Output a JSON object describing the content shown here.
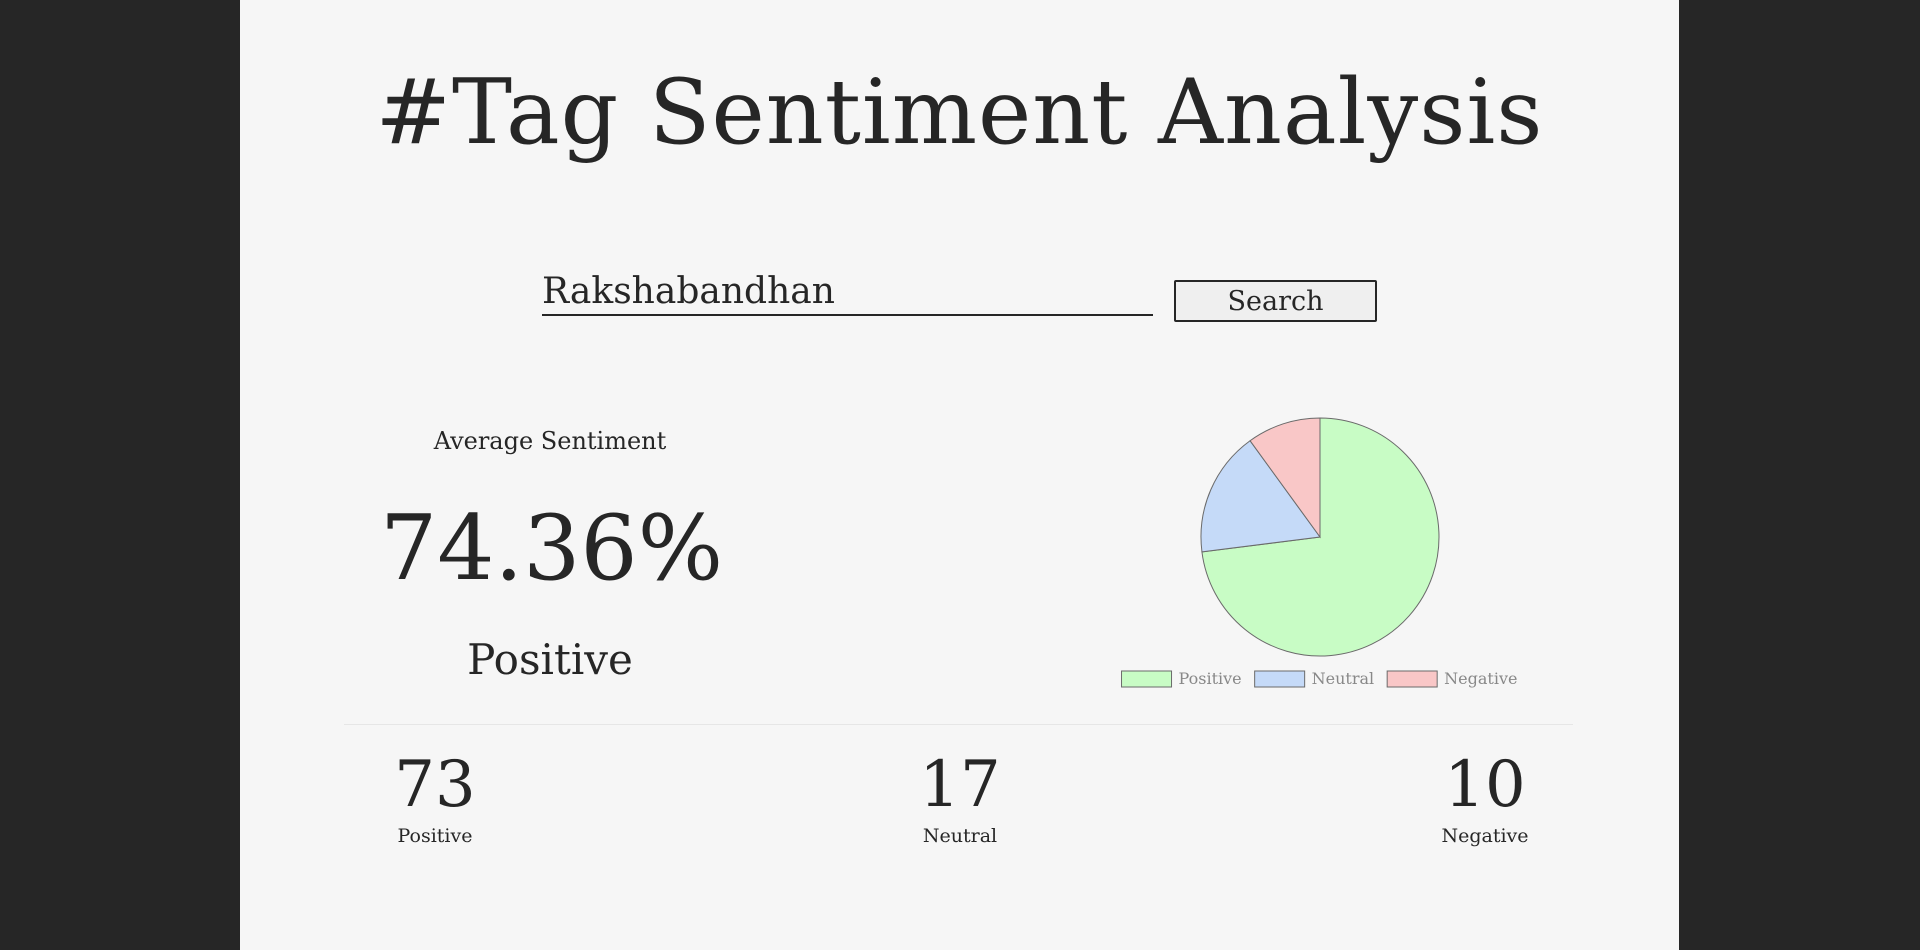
{
  "page": {
    "title": "#Tag Sentiment Analysis"
  },
  "search": {
    "value": "Rakshabandhan",
    "button_label": "Search"
  },
  "average": {
    "label": "Average Sentiment",
    "value": "74.36%",
    "classification": "Positive"
  },
  "colors": {
    "background_outer": "#262626",
    "panel": "#f6f6f6",
    "positive": "#c8fcc5",
    "neutral": "#c5daf8",
    "negative": "#f9c7c7",
    "slice_border": "#6a6a6a",
    "legend_text": "#888888"
  },
  "chart_data": {
    "type": "pie",
    "categories": [
      "Positive",
      "Neutral",
      "Negative"
    ],
    "values": [
      73,
      17,
      10
    ],
    "legend": "bottom"
  },
  "counts": [
    {
      "value": "73",
      "label": "Positive"
    },
    {
      "value": "17",
      "label": "Neutral"
    },
    {
      "value": "10",
      "label": "Negative"
    }
  ]
}
